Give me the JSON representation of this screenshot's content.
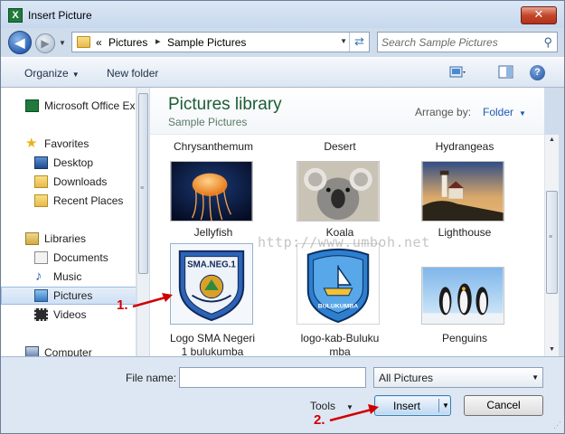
{
  "window": {
    "title": "Insert Picture",
    "close_glyph": "✕"
  },
  "navigation": {
    "back_glyph": "◀",
    "forward_glyph": "▶",
    "breadcrumb_chevron": "«",
    "breadcrumbs": [
      "Pictures",
      "Sample Pictures"
    ],
    "breadcrumb_sep": "▸",
    "refresh_glyph": "⇄",
    "search_placeholder": "Search Sample Pictures",
    "search_glyph": "⚲"
  },
  "toolbar": {
    "organize_label": "Organize",
    "new_folder_label": "New folder",
    "help_glyph": "?"
  },
  "sidebar": {
    "items": [
      {
        "label": "Microsoft Office Ex",
        "icon": "excel-icon"
      },
      {
        "label": "Favorites",
        "icon": "star-icon"
      },
      {
        "label": "Desktop",
        "icon": "desktop-icon"
      },
      {
        "label": "Downloads",
        "icon": "downloads-folder-icon"
      },
      {
        "label": "Recent Places",
        "icon": "recent-places-icon"
      },
      {
        "label": "Libraries",
        "icon": "libraries-icon"
      },
      {
        "label": "Documents",
        "icon": "documents-icon"
      },
      {
        "label": "Music",
        "icon": "music-icon"
      },
      {
        "label": "Pictures",
        "icon": "pictures-icon",
        "selected": true
      },
      {
        "label": "Videos",
        "icon": "videos-icon"
      },
      {
        "label": "Computer",
        "icon": "computer-icon"
      }
    ]
  },
  "library": {
    "title": "Pictures library",
    "subtitle": "Sample Pictures",
    "arrange_label": "Arrange by:",
    "arrange_value": "Folder"
  },
  "files": {
    "top_row": [
      "Chrysanthemum",
      "Desert",
      "Hydrangeas"
    ],
    "items": [
      {
        "label": "Jellyfish",
        "icon": "jellyfish-thumbnail"
      },
      {
        "label": "Koala",
        "icon": "koala-thumbnail"
      },
      {
        "label": "Lighthouse",
        "icon": "lighthouse-thumbnail"
      },
      {
        "label": "Logo SMA Negeri 1 bulukumba",
        "label_line1": "Logo SMA Negeri",
        "label_line2": "1 bulukumba",
        "icon": "sma-logo-thumbnail",
        "seal_text": "SMA.NEG.1"
      },
      {
        "label": "logo-kab-Bulukumba",
        "label_line1": "logo-kab-Buluku",
        "label_line2": "mba",
        "icon": "bulukumba-logo-thumbnail",
        "seal_text": "BULUKUMBA"
      },
      {
        "label": "Penguins",
        "icon": "penguins-thumbnail"
      }
    ]
  },
  "footer": {
    "file_name_label": "File name:",
    "file_name_value": "",
    "filter_value": "All Pictures",
    "tools_label": "Tools",
    "insert_label": "Insert",
    "cancel_label": "Cancel"
  },
  "annotations": {
    "step1": "1.",
    "step2": "2.",
    "watermark": "http://www.umboh.net"
  },
  "colors": {
    "annotation_red": "#d10000",
    "library_title_green": "#1b5d33",
    "link_blue": "#1e5ab4"
  }
}
